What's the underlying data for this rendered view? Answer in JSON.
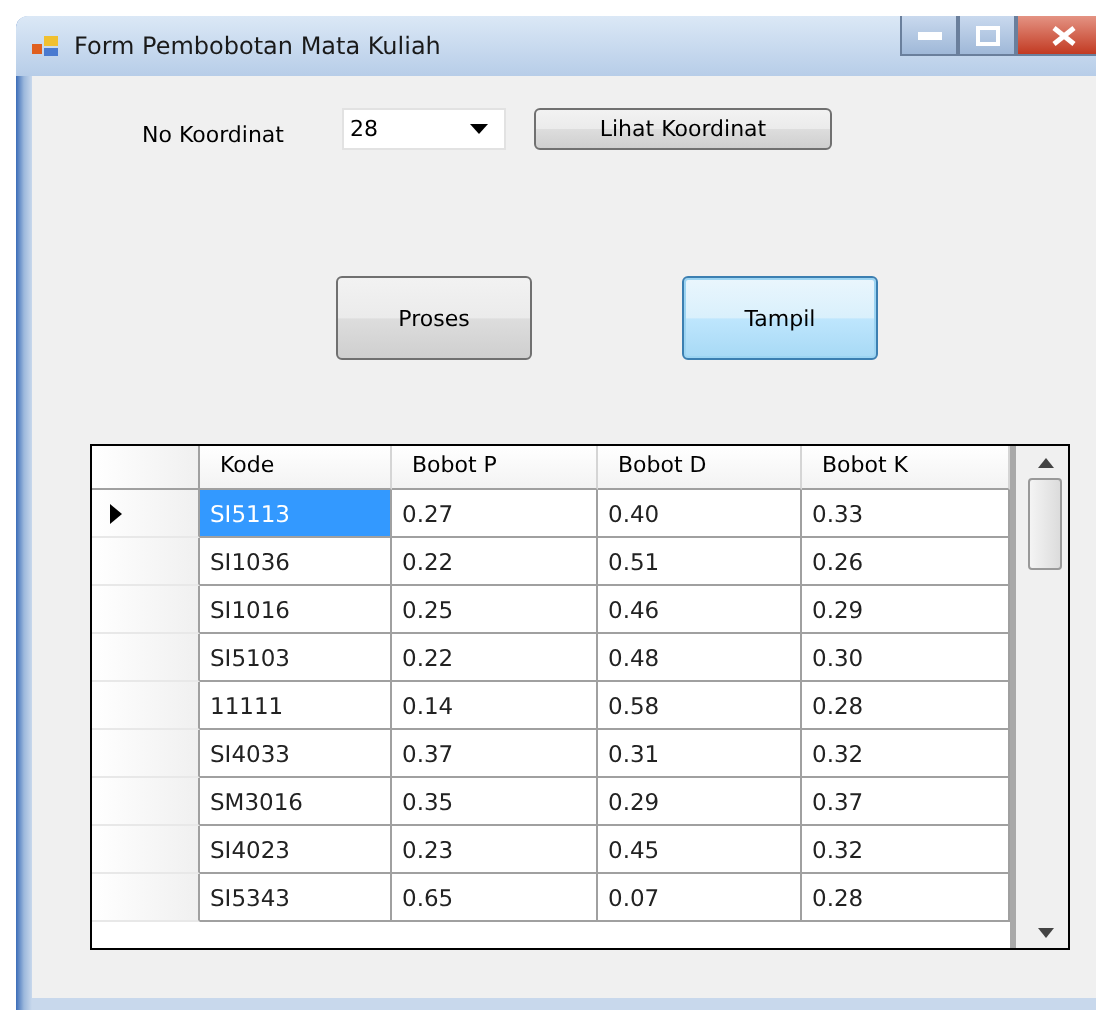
{
  "window": {
    "title": "Form Pembobotan Mata Kuliah"
  },
  "koordinat": {
    "label": "No Koordinat",
    "value": "28",
    "button": "Lihat Koordinat"
  },
  "buttons": [
    {
      "label": "Proses",
      "focused": false
    },
    {
      "label": "Tampil",
      "focused": true
    }
  ],
  "table": {
    "columns": [
      "Kode",
      "Bobot P",
      "Bobot D",
      "Bobot K"
    ],
    "rows": [
      {
        "current": true,
        "cells": [
          {
            "text": "SI5113",
            "selected": true
          },
          {
            "text": "0.27",
            "selected": false
          },
          {
            "text": "0.40",
            "selected": false
          },
          {
            "text": "0.33",
            "selected": false
          }
        ]
      },
      {
        "current": false,
        "cells": [
          {
            "text": "SI1036",
            "selected": false
          },
          {
            "text": "0.22",
            "selected": false
          },
          {
            "text": "0.51",
            "selected": false
          },
          {
            "text": "0.26",
            "selected": false
          }
        ]
      },
      {
        "current": false,
        "cells": [
          {
            "text": "SI1016",
            "selected": false
          },
          {
            "text": "0.25",
            "selected": false
          },
          {
            "text": "0.46",
            "selected": false
          },
          {
            "text": "0.29",
            "selected": false
          }
        ]
      },
      {
        "current": false,
        "cells": [
          {
            "text": "SI5103",
            "selected": false
          },
          {
            "text": "0.22",
            "selected": false
          },
          {
            "text": "0.48",
            "selected": false
          },
          {
            "text": "0.30",
            "selected": false
          }
        ]
      },
      {
        "current": false,
        "cells": [
          {
            "text": "11111",
            "selected": false
          },
          {
            "text": "0.14",
            "selected": false
          },
          {
            "text": "0.58",
            "selected": false
          },
          {
            "text": "0.28",
            "selected": false
          }
        ]
      },
      {
        "current": false,
        "cells": [
          {
            "text": "SI4033",
            "selected": false
          },
          {
            "text": "0.37",
            "selected": false
          },
          {
            "text": "0.31",
            "selected": false
          },
          {
            "text": "0.32",
            "selected": false
          }
        ]
      },
      {
        "current": false,
        "cells": [
          {
            "text": "SM3016",
            "selected": false
          },
          {
            "text": "0.35",
            "selected": false
          },
          {
            "text": "0.29",
            "selected": false
          },
          {
            "text": "0.37",
            "selected": false
          }
        ]
      },
      {
        "current": false,
        "cells": [
          {
            "text": "SI4023",
            "selected": false
          },
          {
            "text": "0.23",
            "selected": false
          },
          {
            "text": "0.45",
            "selected": false
          },
          {
            "text": "0.32",
            "selected": false
          }
        ]
      },
      {
        "current": false,
        "cells": [
          {
            "text": "SI5343",
            "selected": false
          },
          {
            "text": "0.65",
            "selected": false
          },
          {
            "text": "0.07",
            "selected": false
          },
          {
            "text": "0.28",
            "selected": false
          }
        ]
      }
    ]
  }
}
